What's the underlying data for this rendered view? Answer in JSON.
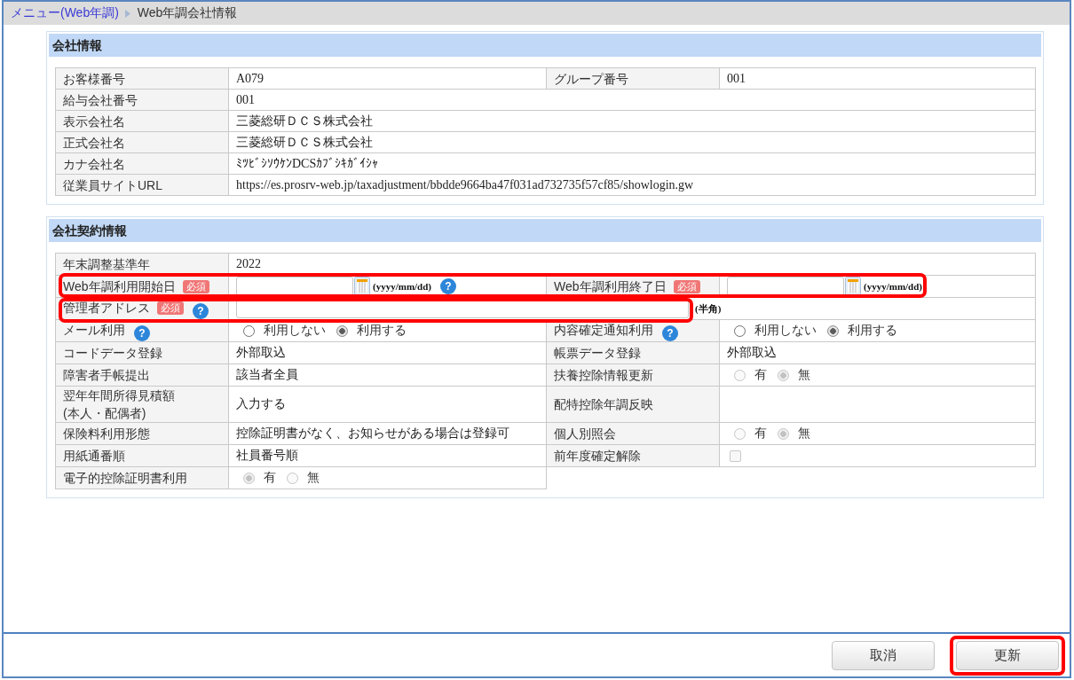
{
  "breadcrumb": {
    "items": [
      {
        "label": "メニュー(Web年調)",
        "kind": "link"
      },
      {
        "label": "Web年調会社情報",
        "kind": "current"
      }
    ]
  },
  "sections": [
    {
      "title": "会社情報",
      "rows": [
        {
          "kind": "pair",
          "highlighted": false,
          "fields": [
            {
              "label": "お客様番号",
              "value": {
                "kind": "text",
                "text": "A079"
              }
            },
            {
              "label": "グループ番号",
              "value": {
                "kind": "text",
                "text": "001"
              }
            }
          ]
        },
        {
          "kind": "full",
          "highlighted": false,
          "fields": [
            {
              "label": "給与会社番号",
              "value": {
                "kind": "text",
                "text": "001"
              }
            }
          ]
        },
        {
          "kind": "full",
          "highlighted": false,
          "fields": [
            {
              "label": "表示会社名",
              "value": {
                "kind": "text",
                "text": "三菱総研ＤＣＳ株式会社"
              }
            }
          ]
        },
        {
          "kind": "full",
          "highlighted": false,
          "fields": [
            {
              "label": "正式会社名",
              "value": {
                "kind": "text",
                "text": "三菱総研ＤＣＳ株式会社"
              }
            }
          ]
        },
        {
          "kind": "full",
          "highlighted": false,
          "fields": [
            {
              "label": "カナ会社名",
              "value": {
                "kind": "text",
                "text": "ﾐﾂﾋﾞｼｿｳｹﾝDCSｶﾌﾞｼｷｶﾞｲｼｬ"
              }
            }
          ]
        },
        {
          "kind": "full",
          "highlighted": false,
          "fields": [
            {
              "label": "従業員サイトURL",
              "value": {
                "kind": "text",
                "text": "https://es.prosrv-web.jp/taxadjustment/bbdde9664ba47f031ad732735f57cf85/showlogin.gw"
              }
            }
          ]
        }
      ]
    },
    {
      "title": "会社契約情報",
      "rows": [
        {
          "kind": "full",
          "highlighted": false,
          "fields": [
            {
              "label": "年末調整基準年",
              "value": {
                "kind": "text",
                "text": "2022"
              }
            }
          ]
        },
        {
          "kind": "pair",
          "highlighted": true,
          "fields": [
            {
              "label": "Web年調利用開始日",
              "badge": "必須",
              "value": {
                "kind": "date",
                "format": "(yyyy/mm/dd)",
                "help": "?"
              }
            },
            {
              "label": "Web年調利用終了日",
              "badge": "必須",
              "value": {
                "kind": "date",
                "format": "(yyyy/mm/dd)"
              }
            }
          ]
        },
        {
          "kind": "full",
          "highlighted": true,
          "fields": [
            {
              "label": "管理者アドレス",
              "badge": "必須",
              "help": "?",
              "value": {
                "kind": "input",
                "note": "(半角)"
              }
            }
          ]
        },
        {
          "kind": "pair",
          "highlighted": false,
          "fields": [
            {
              "label": "メール利用",
              "help": "?",
              "value": {
                "kind": "radio",
                "disabled": false,
                "options": [
                  {
                    "label": "利用しない",
                    "selected": false
                  },
                  {
                    "label": "利用する",
                    "selected": true
                  }
                ]
              }
            },
            {
              "label": "内容確定通知利用",
              "help": "?",
              "value": {
                "kind": "radio",
                "disabled": false,
                "options": [
                  {
                    "label": "利用しない",
                    "selected": false
                  },
                  {
                    "label": "利用する",
                    "selected": true
                  }
                ]
              }
            }
          ]
        },
        {
          "kind": "pair",
          "highlighted": false,
          "fields": [
            {
              "label": "コードデータ登録",
              "value": {
                "kind": "text",
                "text": "外部取込"
              }
            },
            {
              "label": "帳票データ登録",
              "value": {
                "kind": "text",
                "text": "外部取込"
              }
            }
          ]
        },
        {
          "kind": "pair",
          "highlighted": false,
          "fields": [
            {
              "label": "障害者手帳提出",
              "value": {
                "kind": "text",
                "text": "該当者全員"
              }
            },
            {
              "label": "扶養控除情報更新",
              "value": {
                "kind": "radio",
                "disabled": true,
                "options": [
                  {
                    "label": "有",
                    "selected": false
                  },
                  {
                    "label": "無",
                    "selected": true
                  }
                ]
              }
            }
          ]
        },
        {
          "kind": "pair",
          "highlighted": false,
          "fields": [
            {
              "label": "翌年年間所得見積額\n(本人・配偶者)",
              "value": {
                "kind": "text",
                "text": "入力する"
              }
            },
            {
              "label": "配特控除年調反映"
            }
          ]
        },
        {
          "kind": "pair",
          "highlighted": false,
          "fields": [
            {
              "label": "保険料利用形態",
              "value": {
                "kind": "text",
                "text": "控除証明書がなく、お知らせがある場合は登録可"
              }
            },
            {
              "label": "個人別照会",
              "value": {
                "kind": "radio",
                "disabled": true,
                "options": [
                  {
                    "label": "有",
                    "selected": false
                  },
                  {
                    "label": "無",
                    "selected": true
                  }
                ]
              }
            }
          ]
        },
        {
          "kind": "pair",
          "highlighted": false,
          "fields": [
            {
              "label": "用紙通番順",
              "value": {
                "kind": "text",
                "text": "社員番号順"
              }
            },
            {
              "label": "前年度確定解除",
              "value": {
                "kind": "checkbox",
                "checked": false,
                "disabled": true
              }
            }
          ]
        },
        {
          "kind": "half",
          "highlighted": false,
          "fields": [
            {
              "label": "電子的控除証明書利用",
              "value": {
                "kind": "radio",
                "disabled": true,
                "options": [
                  {
                    "label": "有",
                    "selected": true
                  },
                  {
                    "label": "無",
                    "selected": false
                  }
                ]
              }
            }
          ]
        }
      ]
    }
  ],
  "buttons": [
    {
      "label": "取消",
      "highlighted": false
    },
    {
      "label": "更新",
      "highlighted": true
    }
  ]
}
